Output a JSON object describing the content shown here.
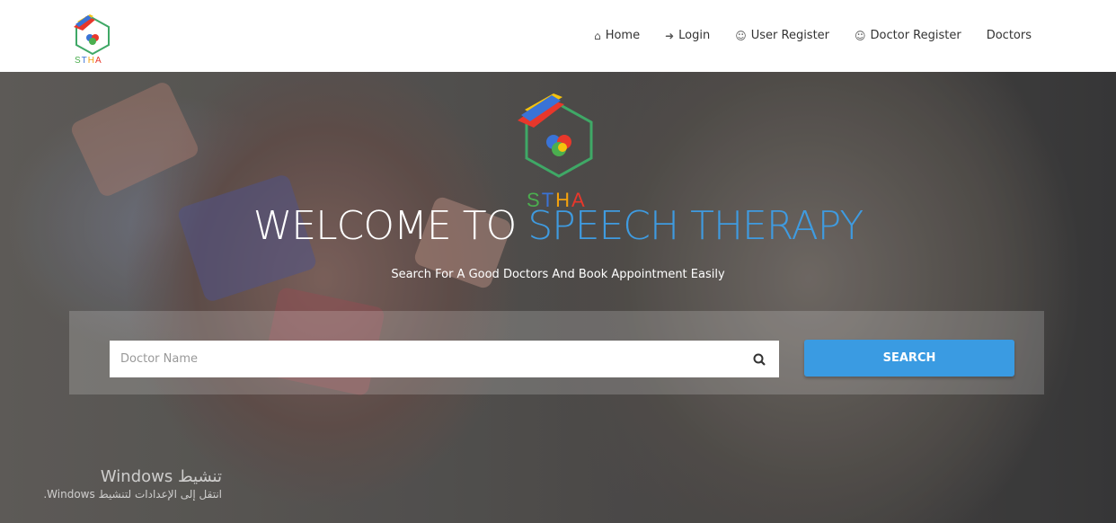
{
  "brand": {
    "logo_text": "STHA"
  },
  "nav": {
    "items": [
      {
        "label": "Home",
        "icon": "home-icon"
      },
      {
        "label": "Login",
        "icon": "login-icon"
      },
      {
        "label": "User Register",
        "icon": "user-icon"
      },
      {
        "label": "Doctor Register",
        "icon": "user-icon"
      },
      {
        "label": "Doctors",
        "icon": ""
      }
    ]
  },
  "hero": {
    "title_prefix": "WELCOME TO",
    "title_accent": "SPEECH THERAPY",
    "tagline": "Search For A Good Doctors And Book Appointment Easily"
  },
  "search": {
    "placeholder": "Doctor Name",
    "value": "",
    "button_label": "SEARCH"
  },
  "watermark": {
    "line1": "تنشيط Windows",
    "line2": "انتقل إلى الإعدادات لتنشيط Windows."
  },
  "colors": {
    "accent": "#3f9be0",
    "button": "#3a9be2"
  }
}
